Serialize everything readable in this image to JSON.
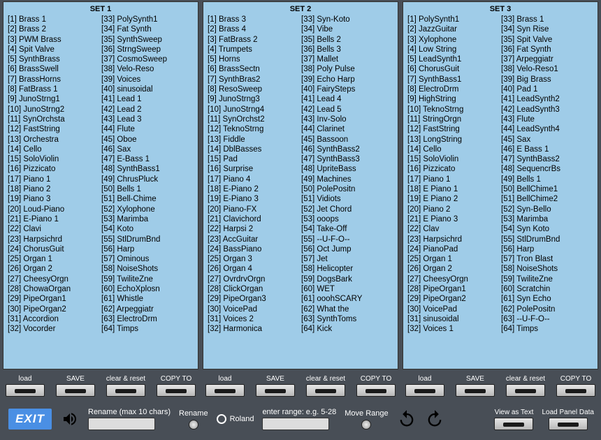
{
  "sets": [
    {
      "title": "SET 1",
      "items": [
        "Brass 1",
        "Brass 2",
        "PWM Brass",
        "Spit Valve",
        "SynthBrass",
        "BrassSwell",
        "BrassHorns",
        "FatBrass 1",
        "JunoStrng1",
        "JunoStrng2",
        "SynOrchsta",
        "FastString",
        "Orchestra",
        "Cello",
        "SoloViolin",
        "Pizzicato",
        "Piano 1",
        "Piano 2",
        "Piano 3",
        "Loud-Piano",
        "E-Piano 1",
        "Clavi",
        "Harpsichrd",
        "ChorusGuit",
        "Organ 1",
        "Organ 2",
        "CheesyOrgn",
        "ChowaOrgan",
        "PipeOrgan1",
        "PipeOrgan2",
        "Accordion",
        "Vocorder",
        "PolySynth1",
        "Fat Synth",
        "SynthSweep",
        "StrngSweep",
        "CosmoSweep",
        "Velo-Reso",
        " Voices",
        "sinusoidal",
        "Lead 1",
        "Lead 2",
        "Lead 3",
        "Flute",
        "Oboe",
        "Sax",
        "E-Bass 1",
        "SynthBass1",
        "ChrusPluck",
        "Bells 1",
        "Bell-Chime",
        "Xylophone",
        "Marimba",
        "Koto",
        "StlDrumBnd",
        "Harp",
        "Ominous",
        "NoiseShots",
        "TwiliteZne",
        "EchoXplosn",
        "Whistle",
        "Arpeggiatr",
        "ElectroDrm",
        "Timps"
      ]
    },
    {
      "title": "SET 2",
      "items": [
        "Brass 3",
        "Brass 4",
        "FatBrass 2",
        "Trumpets",
        "Horns",
        "BrassSectn",
        "SynthBras2",
        "ResoSweep",
        "JunoStrng3",
        "JunoStrng4",
        "SynOrchst2",
        "TeknoStrng",
        "Fiddle",
        "DblBasses",
        "Pad",
        "Surprise",
        "Piano 4",
        "E-Piano 2",
        "E-Piano 3",
        "Piano-FX",
        "Clavichord",
        "Harpsi 2",
        "AccGuitar",
        "BassPiano",
        "Organ 3",
        "Organ 4",
        "OvrdrvOrgn",
        "ClickOrgan",
        "PipeOrgan3",
        "VoicePad",
        "Voices 2",
        "Harmonica",
        "Syn-Koto",
        "Vibe",
        "Bells 2",
        "Bells 3",
        "Mallet",
        "Poly Pulse",
        "Echo Harp",
        "FairySteps",
        "Lead 4",
        "Lead 5",
        "Inv-Solo",
        "Clarinet",
        "Bassoon",
        "SynthBass2",
        "SynthBass3",
        "UpriteBass",
        "Machines",
        "PolePositn",
        "Vidiots",
        "Jet Chord",
        "ooops",
        "Take-Off",
        "--U-F-O--",
        "Oct Jump",
        "Jet",
        "Helicopter",
        "DogsBark",
        "WET",
        "ooohSCARY",
        "What the",
        "SynthToms",
        "Kick"
      ]
    },
    {
      "title": "SET 3",
      "items": [
        "PolySynth1",
        "JazzGuitar",
        "Xylophone",
        "Low String",
        "LeadSynth1",
        "ChorusGuit",
        "SynthBass1",
        "ElectroDrm",
        "HighString",
        "TeknoStrng",
        "StringOrgn",
        "FastString",
        "LongString",
        "Cello",
        "SoloViolin",
        "Pizzicato",
        "Piano 1",
        "E Piano 1",
        "E Piano 2",
        "Piano 2",
        "E Piano 3",
        "Clav",
        "Harpsichrd",
        "PianoPad",
        "Organ 1",
        "Organ 2",
        "CheesyOrgn",
        "PipeOrgan1",
        "PipeOrgan2",
        "VoicePad",
        "sinusoidal",
        " Voices 1",
        "Brass 1",
        "Syn Rise",
        "Spit Valve",
        "Fat Synth",
        "Arpeggiatr",
        "Velo-Reso1",
        "Big Brass",
        "Pad 1",
        "LeadSynth2",
        "LeadSynth3",
        "Flute",
        "LeadSynth4",
        "Sax",
        "E Bass 1",
        "SynthBass2",
        "SequencrBs",
        "Bells 1",
        "BellChime1",
        "BellChime2",
        "Syn-Bello",
        "Marimba",
        "Syn Koto",
        "StlDrumBnd",
        "Harp",
        "Tron Blast",
        "NoiseShots",
        "TwiliteZne",
        "Scratchin",
        "Syn Echo",
        "PolePositn",
        "--U-F-O--",
        "Timps"
      ]
    }
  ],
  "set_buttons": {
    "load": "load",
    "save": "SAVE",
    "clear": "clear & reset",
    "copy": "COPY TO"
  },
  "bottom": {
    "exit": "EXIT",
    "rename_label": "Rename (max 10 chars)",
    "rename_btn": "Rename",
    "roland": "Roland",
    "range_label": "enter range: e.g. 5-28",
    "move_range": "Move Range",
    "view_text": "View as Text",
    "load_panel": "Load Panel Data"
  }
}
